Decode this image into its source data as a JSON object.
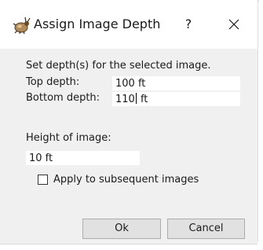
{
  "window": {
    "title": "Assign Image Depth",
    "help_glyph": "?",
    "close_icon": "close-icon",
    "app_icon": "app-bug-icon"
  },
  "form": {
    "instruction": "Set depth(s) for the selected image.",
    "top_depth_label": "Top depth:",
    "top_depth_value": "100 ft",
    "bottom_depth_label": "Bottom depth:",
    "bottom_depth_value_before_caret": "110",
    "bottom_depth_value_after_caret": " ft",
    "height_label": "Height of image:",
    "height_value": "10 ft",
    "apply_label": "Apply to subsequent images",
    "apply_checked": false
  },
  "buttons": {
    "ok_label": "Ok",
    "cancel_label": "Cancel"
  },
  "colors": {
    "dialog_bg": "#f0f0f0",
    "titlebar_bg": "#ffffff",
    "button_bg": "#e1e1e1",
    "button_border": "#adadad"
  }
}
